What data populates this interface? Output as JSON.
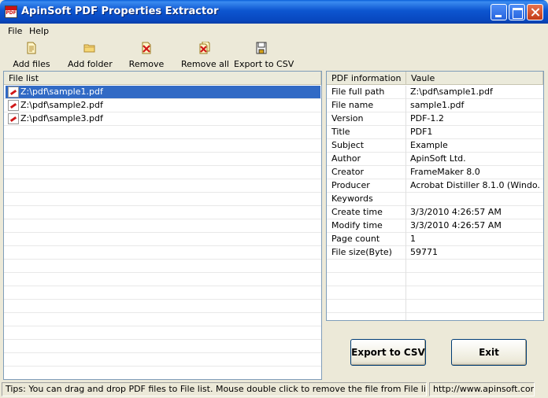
{
  "window": {
    "title": "ApinSoft PDF Properties Extractor"
  },
  "menu": {
    "items": [
      {
        "label": "File"
      },
      {
        "label": "Help"
      }
    ]
  },
  "toolbar": {
    "items": [
      {
        "label": "Add files",
        "icon": "add-files-icon"
      },
      {
        "label": "Add folder",
        "icon": "folder-icon"
      },
      {
        "label": "Remove",
        "icon": "remove-icon"
      },
      {
        "label": "Remove all",
        "icon": "remove-all-icon"
      },
      {
        "label": "Export to CSV",
        "icon": "save-icon"
      }
    ]
  },
  "file_list": {
    "header": "File list",
    "items": [
      {
        "path": "Z:\\pdf\\sample1.pdf",
        "selected": true
      },
      {
        "path": "Z:\\pdf\\sample2.pdf",
        "selected": false
      },
      {
        "path": "Z:\\pdf\\sample3.pdf",
        "selected": false
      }
    ]
  },
  "pdf_info": {
    "col_info": "PDF information",
    "col_value": "Vaule",
    "rows": [
      {
        "key": "File full path",
        "value": "Z:\\pdf\\sample1.pdf"
      },
      {
        "key": "File name",
        "value": "sample1.pdf"
      },
      {
        "key": "Version",
        "value": "PDF-1.2"
      },
      {
        "key": "Title",
        "value": "PDF1"
      },
      {
        "key": "Subject",
        "value": "Example"
      },
      {
        "key": "Author",
        "value": "ApinSoft Ltd."
      },
      {
        "key": "Creator",
        "value": "FrameMaker 8.0"
      },
      {
        "key": "Producer",
        "value": "Acrobat Distiller 8.1.0 (Windo..."
      },
      {
        "key": "Keywords",
        "value": ""
      },
      {
        "key": "Create time",
        "value": "3/3/2010 4:26:57 AM"
      },
      {
        "key": "Modify time",
        "value": "3/3/2010 4:26:57 AM"
      },
      {
        "key": "Page count",
        "value": "1"
      },
      {
        "key": "File size(Byte)",
        "value": "59771"
      }
    ]
  },
  "buttons": {
    "export_label": "Export to CSV",
    "exit_label": "Exit"
  },
  "status": {
    "tips": "Tips: You can drag and drop PDF files to File list. Mouse double click to remove the file from File list.",
    "url": "http://www.apinsoft.com"
  },
  "colors": {
    "title_blue": "#0a5fd8",
    "selection": "#316ac5",
    "window_bg": "#ece9d8"
  }
}
